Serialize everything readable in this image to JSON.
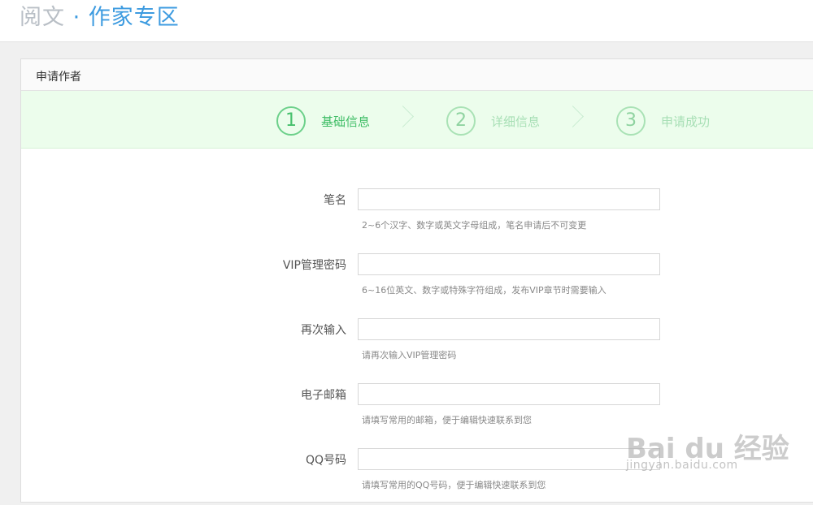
{
  "brand": {
    "part1": "阅文",
    "separator": " · ",
    "part2": "作家专区"
  },
  "panel": {
    "title": "申请作者"
  },
  "steps": [
    {
      "number": "1",
      "label": "基础信息",
      "active": true
    },
    {
      "number": "2",
      "label": "详细信息",
      "active": false
    },
    {
      "number": "3",
      "label": "申请成功",
      "active": false
    }
  ],
  "form": {
    "fields": [
      {
        "label": "笔名",
        "value": "",
        "hint": "2~6个汉字、数字或英文字母组成，笔名申请后不可变更"
      },
      {
        "label": "VIP管理密码",
        "value": "",
        "hint": "6~16位英文、数字或特殊字符组成，发布VIP章节时需要输入"
      },
      {
        "label": "再次输入",
        "value": "",
        "hint": "请再次输入VIP管理密码"
      },
      {
        "label": "电子邮箱",
        "value": "",
        "hint": "请填写常用的邮箱，便于编辑快速联系到您"
      },
      {
        "label": "QQ号码",
        "value": "",
        "hint": "请填写常用的QQ号码，便于编辑快速联系到您"
      }
    ]
  },
  "watermark": {
    "text": "Bai du 经验",
    "sub": "jingyan.baidu.com"
  },
  "colors": {
    "brand_gray": "#b9bfc6",
    "brand_blue": "#3d9be0",
    "step_green": "#3fbd66",
    "steps_bg": "#ecfdec"
  }
}
